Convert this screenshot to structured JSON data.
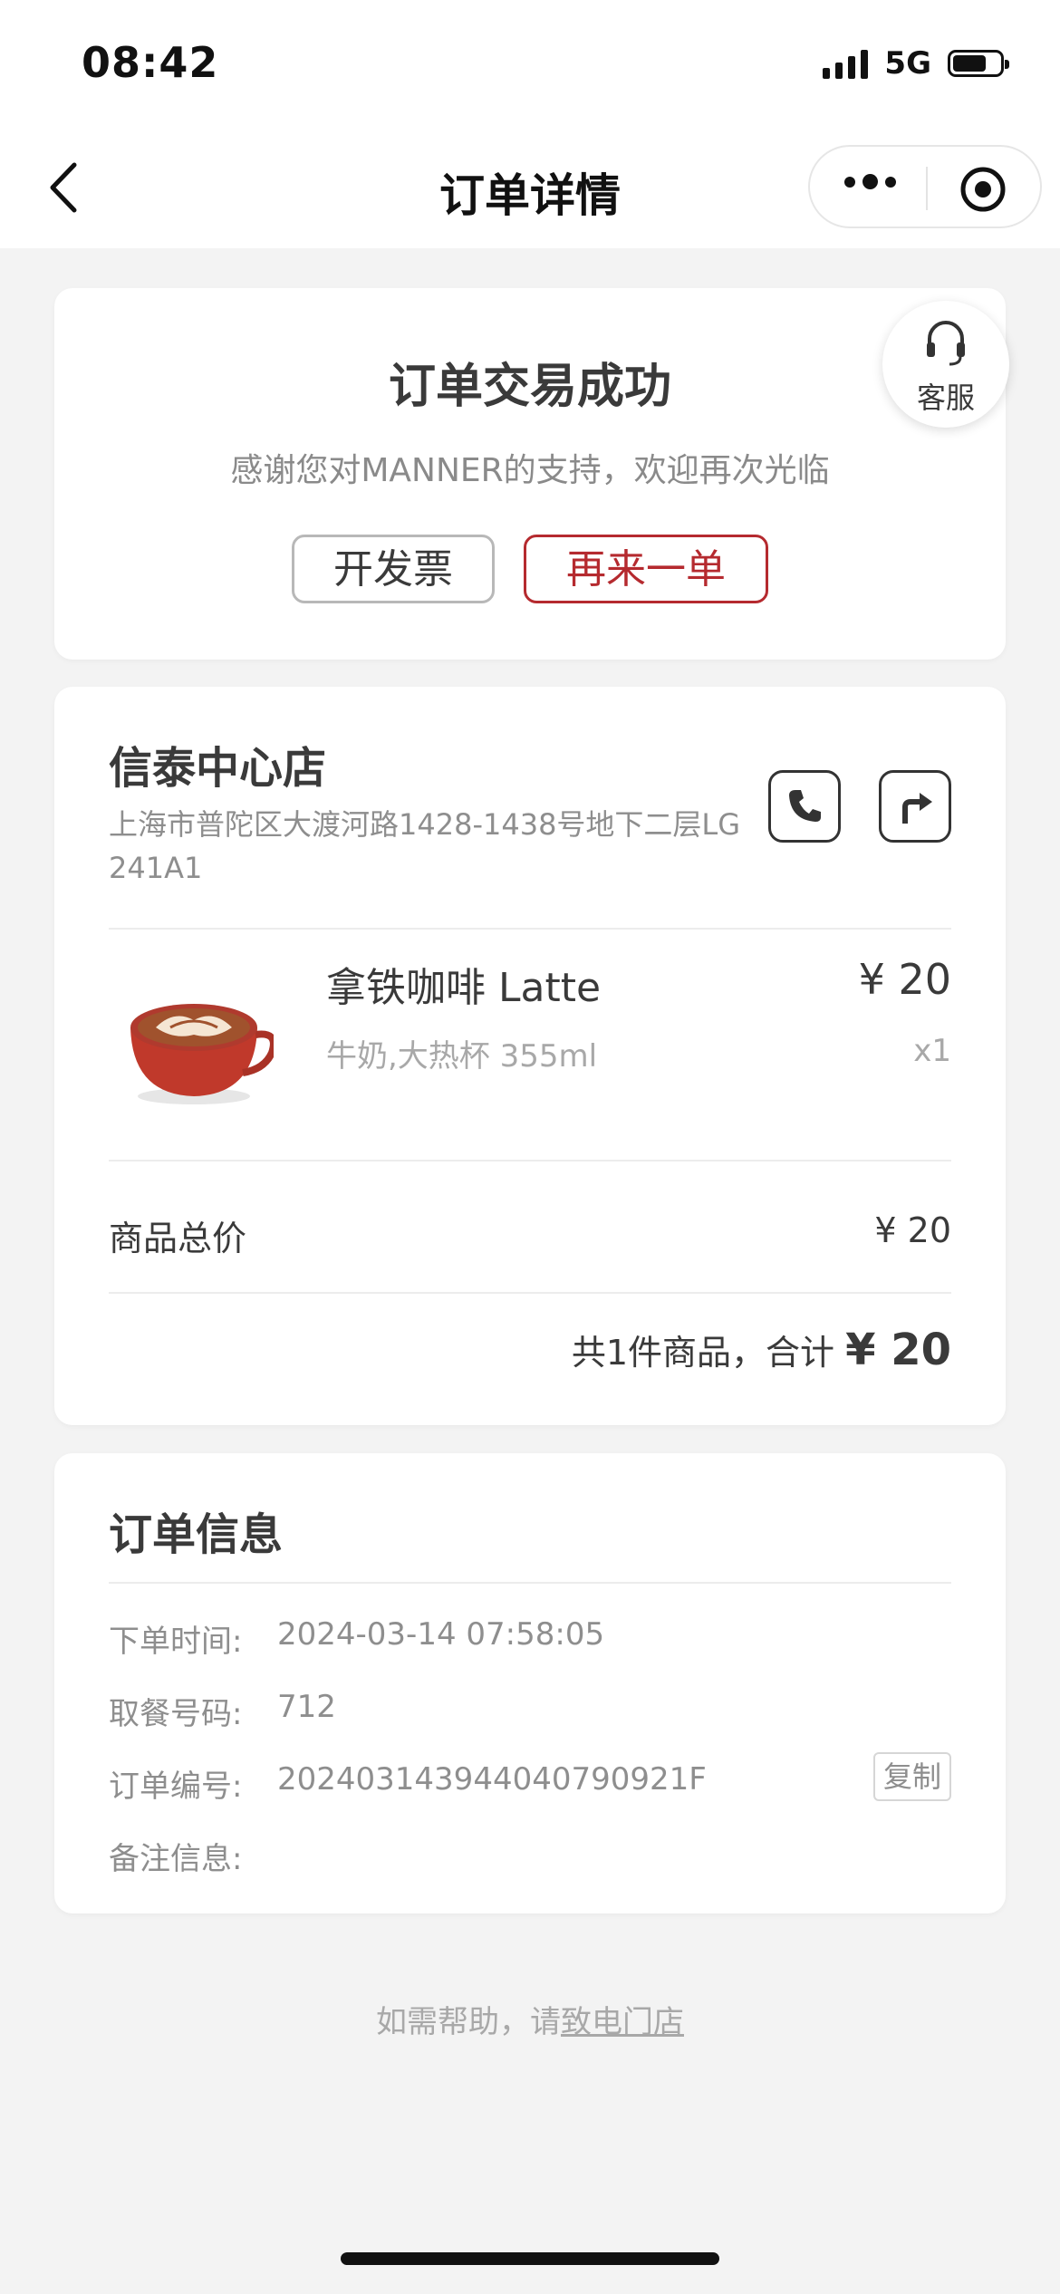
{
  "status_bar": {
    "time": "08:42",
    "network": "5G"
  },
  "nav": {
    "title": "订单详情"
  },
  "order_status": {
    "title": "订单交易成功",
    "subtitle": "感谢您对MANNER的支持，欢迎再次光临",
    "invoice_button": "开发票",
    "reorder_button": "再来一单",
    "service_label": "客服"
  },
  "store": {
    "name": "信泰中心店",
    "address": "上海市普陀区大渡河路1428-1438号地下二层LG241A1"
  },
  "product": {
    "name": "拿铁咖啡 Latte",
    "spec": "牛奶,大热杯 355ml",
    "price": "¥ 20",
    "qty": "x1"
  },
  "totals": {
    "goods_total_label": "商品总价",
    "goods_total_value": "¥ 20",
    "summary_prefix": "共1件商品，合计",
    "summary_amount": "¥ 20"
  },
  "order_info": {
    "title": "订单信息",
    "rows": [
      {
        "label": "下单时间:",
        "value": "2024-03-14 07:58:05"
      },
      {
        "label": "取餐号码:",
        "value": "712"
      },
      {
        "label": "订单编号:",
        "value": "20240314394404079092​1F"
      },
      {
        "label": "备注信息:",
        "value": ""
      }
    ],
    "copy_button": "复制"
  },
  "help": {
    "prefix": "如需帮助，请",
    "link": "致电门店"
  },
  "colors": {
    "accent": "#b52a2f",
    "background": "#f3f3f3",
    "card": "#ffffff"
  }
}
